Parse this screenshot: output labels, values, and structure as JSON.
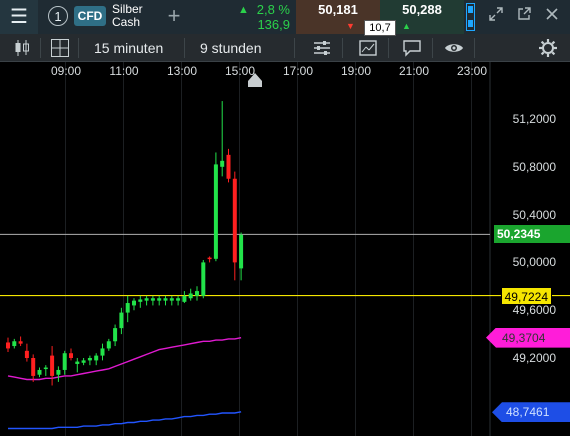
{
  "topbar": {
    "menu_icon": "hamburger-icon",
    "instrument_number": "1",
    "instrument_type": "CFD",
    "instrument_name_line1": "Silber",
    "instrument_name_line2": "Cash",
    "add_icon": "plus-icon",
    "change_percent": "2,8 %",
    "change_absolute": "136,9",
    "sell_price": "50,181",
    "spread": "10,7",
    "buy_price": "50,288",
    "window_icons": [
      "expand-icon",
      "popout-icon",
      "close-icon"
    ],
    "colors": {
      "up": "#2bd14b",
      "down": "#ff3b30",
      "sell_bg": "#4a3428",
      "buy_bg": "#213b33"
    }
  },
  "toolbar": {
    "chart_type_icon": "candlestick-icon",
    "layout_icon": "grid-icon",
    "interval": "15 minuten",
    "period": "9 stunden",
    "tool_icons": [
      "indicators-icon",
      "chart-tools-icon",
      "comment-icon",
      "eye-icon",
      "settings-icon"
    ]
  },
  "chart": {
    "time_labels": [
      "09:00",
      "11:00",
      "13:00",
      "15:00",
      "17:00",
      "19:00",
      "21:00",
      "23:00"
    ],
    "price_labels": [
      "51,2000",
      "50,8000",
      "50,4000",
      "50,0000",
      "49,6000",
      "49,2000"
    ],
    "current_price": "50,2345",
    "yellow_level": "49,7224",
    "ma_pink_value": "49,3704",
    "ma_blue_value": "48,7461",
    "colors": {
      "bull": "#22e34a",
      "bear": "#ff2020",
      "ma_pink": "#e01ad0",
      "ma_blue": "#2255ff",
      "yellow_line": "#f5e600",
      "current_line": "#b0b0b0"
    }
  },
  "chart_data": {
    "type": "candlestick",
    "instrument": "Silber Cash",
    "interval": "15 minuten",
    "x_labels": [
      "09:00",
      "11:00",
      "13:00",
      "15:00",
      "17:00",
      "19:00",
      "21:00",
      "23:00"
    ],
    "ylim": [
      48.6,
      51.5
    ],
    "candles": [
      {
        "o": 49.33,
        "h": 49.37,
        "l": 49.25,
        "c": 49.28
      },
      {
        "o": 49.3,
        "h": 49.36,
        "l": 49.28,
        "c": 49.34
      },
      {
        "o": 49.34,
        "h": 49.38,
        "l": 49.3,
        "c": 49.32
      },
      {
        "o": 49.26,
        "h": 49.32,
        "l": 49.17,
        "c": 49.2
      },
      {
        "o": 49.2,
        "h": 49.23,
        "l": 49.0,
        "c": 49.05
      },
      {
        "o": 49.06,
        "h": 49.12,
        "l": 49.04,
        "c": 49.1
      },
      {
        "o": 49.11,
        "h": 49.14,
        "l": 49.05,
        "c": 49.12
      },
      {
        "o": 49.22,
        "h": 49.3,
        "l": 48.97,
        "c": 49.05
      },
      {
        "o": 49.06,
        "h": 49.13,
        "l": 49.0,
        "c": 49.1
      },
      {
        "o": 49.1,
        "h": 49.26,
        "l": 49.06,
        "c": 49.24
      },
      {
        "o": 49.24,
        "h": 49.28,
        "l": 49.18,
        "c": 49.2
      },
      {
        "o": 49.15,
        "h": 49.2,
        "l": 49.08,
        "c": 49.17
      },
      {
        "o": 49.16,
        "h": 49.2,
        "l": 49.14,
        "c": 49.18
      },
      {
        "o": 49.18,
        "h": 49.22,
        "l": 49.14,
        "c": 49.2
      },
      {
        "o": 49.18,
        "h": 49.24,
        "l": 49.14,
        "c": 49.22
      },
      {
        "o": 49.22,
        "h": 49.32,
        "l": 49.18,
        "c": 49.28
      },
      {
        "o": 49.28,
        "h": 49.36,
        "l": 49.26,
        "c": 49.34
      },
      {
        "o": 49.34,
        "h": 49.48,
        "l": 49.3,
        "c": 49.45
      },
      {
        "o": 49.45,
        "h": 49.62,
        "l": 49.4,
        "c": 49.58
      },
      {
        "o": 49.58,
        "h": 49.72,
        "l": 49.5,
        "c": 49.66
      },
      {
        "o": 49.64,
        "h": 49.7,
        "l": 49.6,
        "c": 49.68
      },
      {
        "o": 49.67,
        "h": 49.72,
        "l": 49.62,
        "c": 49.69
      },
      {
        "o": 49.68,
        "h": 49.72,
        "l": 49.64,
        "c": 49.7
      },
      {
        "o": 49.68,
        "h": 49.72,
        "l": 49.64,
        "c": 49.7
      },
      {
        "o": 49.68,
        "h": 49.72,
        "l": 49.64,
        "c": 49.7
      },
      {
        "o": 49.68,
        "h": 49.72,
        "l": 49.64,
        "c": 49.7
      },
      {
        "o": 49.68,
        "h": 49.72,
        "l": 49.64,
        "c": 49.7
      },
      {
        "o": 49.68,
        "h": 49.72,
        "l": 49.64,
        "c": 49.7
      },
      {
        "o": 49.67,
        "h": 49.76,
        "l": 49.66,
        "c": 49.72
      },
      {
        "o": 49.7,
        "h": 49.78,
        "l": 49.68,
        "c": 49.74
      },
      {
        "o": 49.72,
        "h": 49.8,
        "l": 49.68,
        "c": 49.76
      },
      {
        "o": 49.72,
        "h": 50.02,
        "l": 49.7,
        "c": 50.0
      },
      {
        "o": 50.04,
        "h": 50.05,
        "l": 50.0,
        "c": 50.03
      },
      {
        "o": 50.03,
        "h": 50.92,
        "l": 50.01,
        "c": 50.82
      },
      {
        "o": 50.8,
        "h": 51.35,
        "l": 50.72,
        "c": 50.85
      },
      {
        "o": 50.9,
        "h": 50.95,
        "l": 50.67,
        "c": 50.7
      },
      {
        "o": 50.7,
        "h": 50.76,
        "l": 49.85,
        "c": 50.0
      },
      {
        "o": 49.95,
        "h": 50.25,
        "l": 49.85,
        "c": 50.23
      }
    ],
    "series": [
      {
        "name": "MA pink",
        "values": [
          49.05,
          49.04,
          49.03,
          49.02,
          49.02,
          49.02,
          49.03,
          49.03,
          49.04,
          49.05,
          49.05,
          49.06,
          49.07,
          49.08,
          49.09,
          49.1,
          49.11,
          49.13,
          49.15,
          49.17,
          49.19,
          49.21,
          49.23,
          49.25,
          49.27,
          49.28,
          49.29,
          49.3,
          49.31,
          49.32,
          49.33,
          49.34,
          49.34,
          49.35,
          49.35,
          49.36,
          49.36,
          49.37
        ]
      },
      {
        "name": "MA blue",
        "values": [
          48.61,
          48.61,
          48.61,
          48.61,
          48.61,
          48.61,
          48.61,
          48.61,
          48.62,
          48.62,
          48.62,
          48.62,
          48.63,
          48.63,
          48.63,
          48.64,
          48.64,
          48.65,
          48.65,
          48.66,
          48.66,
          48.67,
          48.67,
          48.68,
          48.68,
          48.69,
          48.69,
          48.7,
          48.71,
          48.71,
          48.72,
          48.72,
          48.73,
          48.73,
          48.74,
          48.74,
          48.74,
          48.75
        ]
      }
    ],
    "horizontal_lines": [
      50.2345,
      49.7224
    ]
  }
}
